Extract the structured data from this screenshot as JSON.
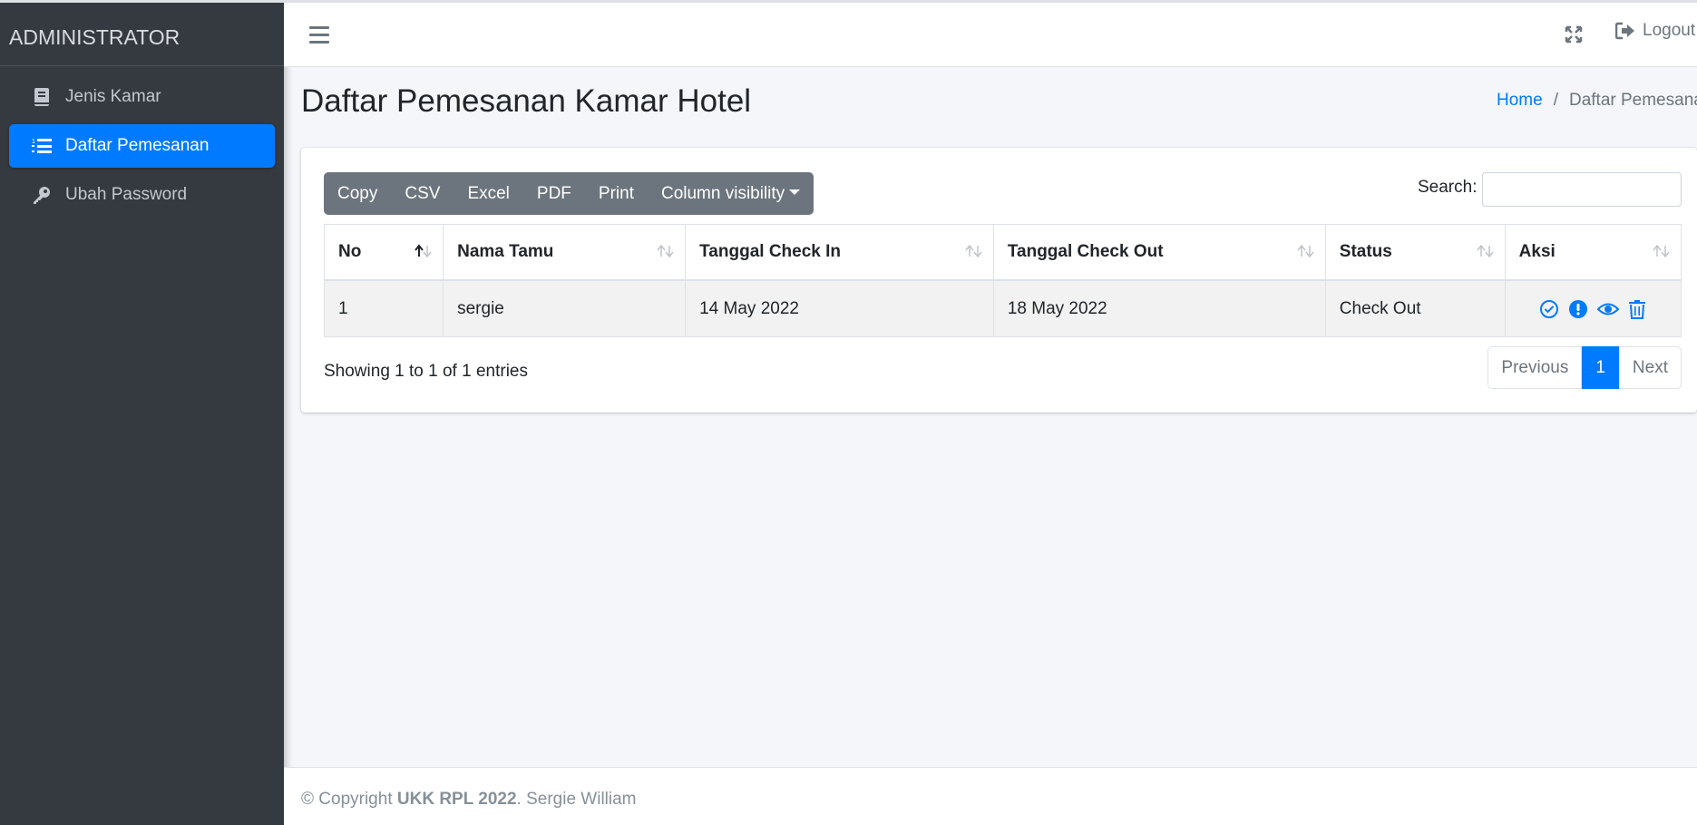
{
  "sidebar": {
    "brand": "ADMINISTRATOR",
    "items": [
      {
        "label": "Jenis Kamar",
        "icon": "book-icon",
        "active": false
      },
      {
        "label": "Daftar Pemesanan",
        "icon": "list-icon",
        "active": true
      },
      {
        "label": "Ubah Password",
        "icon": "key-icon",
        "active": false
      }
    ]
  },
  "topbar": {
    "menu_icon": "hamburger-icon",
    "fullscreen_icon": "expand-icon",
    "logout_label": "Logout"
  },
  "header": {
    "title": "Daftar Pemesanan Kamar Hotel",
    "breadcrumb": [
      "Home",
      "Daftar Pemesanan"
    ]
  },
  "toolbar": {
    "buttons": [
      "Copy",
      "CSV",
      "Excel",
      "PDF",
      "Print",
      "Column visibility"
    ],
    "search_label": "Search:",
    "search_value": ""
  },
  "table": {
    "columns": [
      "No",
      "Nama Tamu",
      "Tanggal Check In",
      "Tanggal Check Out",
      "Status",
      "Aksi"
    ],
    "rows": [
      {
        "no": "1",
        "nama": "sergie",
        "check_in": "14 May 2022",
        "check_out": "18 May 2022",
        "status": "Check Out",
        "actions": [
          "check-circle-icon",
          "exclamation-circle-icon",
          "eye-icon",
          "trash-icon"
        ]
      }
    ]
  },
  "pagination": {
    "info": "Showing 1 to 1 of 1 entries",
    "previous": "Previous",
    "current": "1",
    "next": "Next"
  },
  "footer": {
    "prefix": "© Copyright ",
    "bold": "UKK RPL 2022",
    "suffix": ". Sergie William"
  },
  "colors": {
    "sidebar_bg": "#343a40",
    "accent": "#007bff",
    "button_gray": "#6c757d"
  }
}
